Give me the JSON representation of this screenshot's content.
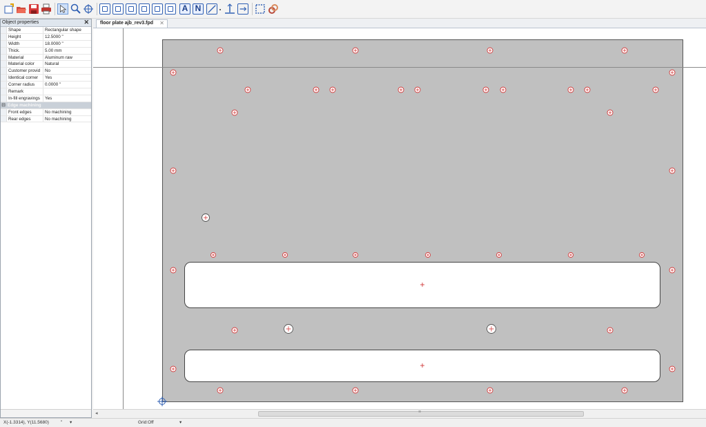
{
  "toolbar": {
    "icons": [
      "new-icon",
      "open-icon",
      "save-icon",
      "print-icon",
      "select-arrow-icon",
      "zoom-icon",
      "pan-icon",
      "shape-1-icon",
      "shape-2-icon",
      "shape-3-icon",
      "shape-4-icon",
      "shape-5-icon",
      "shape-6-icon",
      "text-tool-icon",
      "engrave-text-icon",
      "line-tool-icon",
      "dimension-icon",
      "measure-icon",
      "frame-icon",
      "check-icon"
    ],
    "letter_a": "A",
    "letter_n": "N"
  },
  "panel": {
    "title": "Object properties",
    "close": "✕",
    "properties": [
      {
        "key": "Shape",
        "value": "Rectangular shape"
      },
      {
        "key": "Height",
        "value": "12.5000 \""
      },
      {
        "key": "Width",
        "value": "18.0000 \""
      },
      {
        "key": "Thick.",
        "value": "5.00 mm"
      },
      {
        "key": "Material",
        "value": "Aluminum raw"
      },
      {
        "key": "Material color",
        "value": "Natural"
      },
      {
        "key": "Customer provid",
        "value": "No"
      },
      {
        "key": "Identical corner",
        "value": "Yes"
      },
      {
        "key": "Corner radius",
        "value": "0.0000 \""
      },
      {
        "key": "Remark",
        "value": ""
      },
      {
        "key": "In-fill engravings",
        "value": "Yes"
      }
    ],
    "category": {
      "toggle": "⊟",
      "label": "Edge machining"
    },
    "edge_properties": [
      {
        "key": "Front edges",
        "value": "No machining"
      },
      {
        "key": "Rear edges",
        "value": "No machining"
      }
    ]
  },
  "tab": {
    "label": "floor plate ajb_rev3.fpd",
    "close": "✕"
  },
  "scroll": {
    "left_arrow": "◂",
    "grip": "≡"
  },
  "status": {
    "coordinates": "X(-1.3314), Y(11.5680)",
    "unit": "\"",
    "unit_dropdown": "▾",
    "grid": "Grid:Off",
    "grid_dropdown": "▾"
  },
  "colors": {
    "plate": "#c0c0c0",
    "plate_border": "#555555",
    "hole": "#d23b3b",
    "accent": "#2f5fb3"
  }
}
